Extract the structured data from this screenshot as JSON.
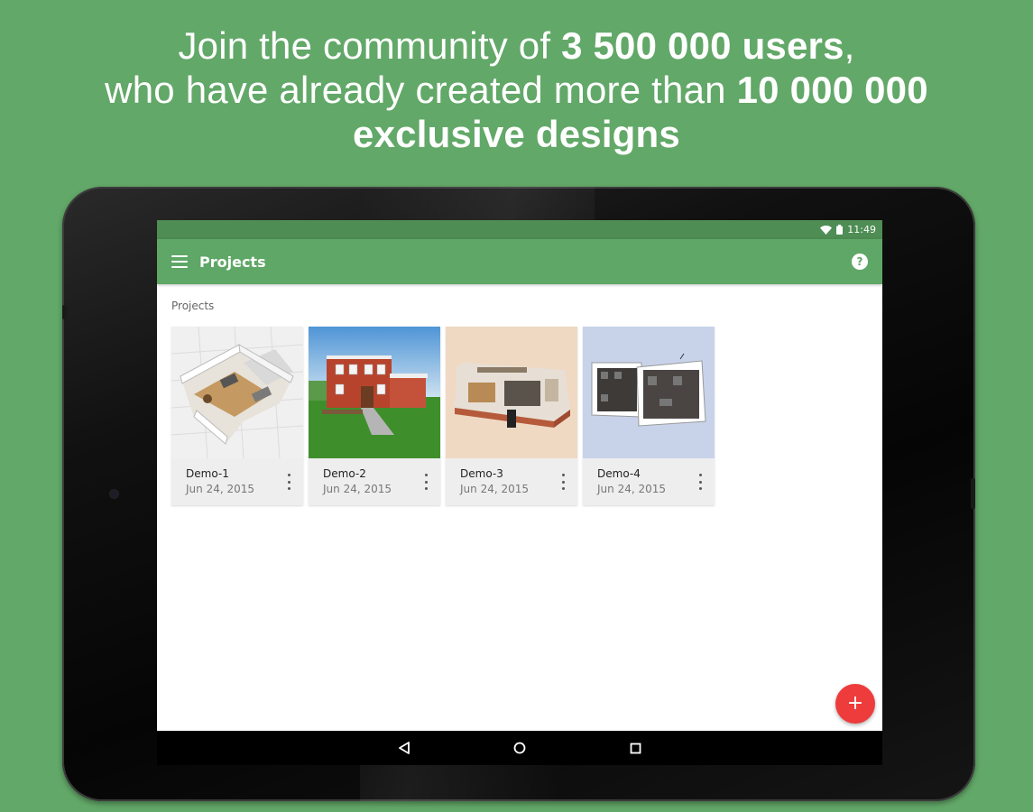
{
  "headline": {
    "line1_pre": "Join the community of ",
    "line1_bold": "3 500 000 users",
    "line1_post": ",",
    "line2_pre": "who have already created more than ",
    "line2_bold": "10 000 000",
    "line3_bold": "exclusive designs"
  },
  "status_bar": {
    "time": "11:49"
  },
  "app_bar": {
    "title": "Projects"
  },
  "section_label": "Projects",
  "projects": [
    {
      "name": "Demo-1",
      "date": "Jun 24, 2015"
    },
    {
      "name": "Demo-2",
      "date": "Jun 24, 2015"
    },
    {
      "name": "Demo-3",
      "date": "Jun 24, 2015"
    },
    {
      "name": "Demo-4",
      "date": "Jun 24, 2015"
    }
  ],
  "fab": {
    "label": "+"
  },
  "icons": {
    "menu": "menu-icon",
    "help": "help-icon",
    "more": "more-vert-icon",
    "add": "add-icon",
    "back": "back-icon",
    "home": "home-icon",
    "recents": "recents-icon"
  },
  "colors": {
    "background": "#62a868",
    "app_bar": "#5fa766",
    "status_bar": "#4e8d54",
    "fab": "#ee3b3b"
  }
}
